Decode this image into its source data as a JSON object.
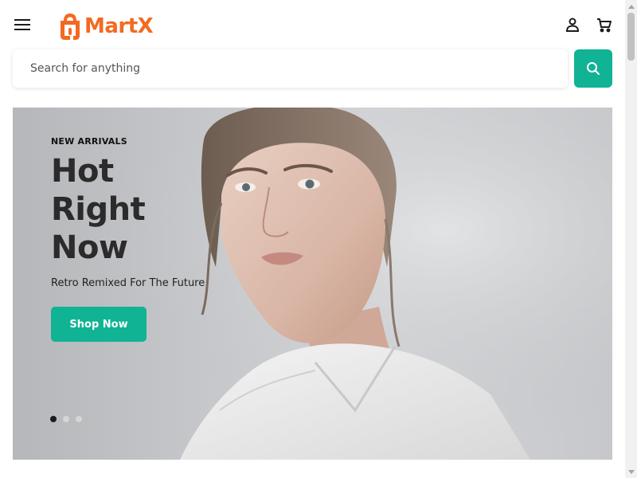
{
  "header": {
    "logo_text": "MartX",
    "brand_color": "#f26a21",
    "icons": [
      "hamburger-menu-icon",
      "shopping-bag-logo-icon",
      "user-icon",
      "cart-icon"
    ]
  },
  "search": {
    "placeholder": "Search for anything",
    "value": "",
    "button_icon": "search-icon",
    "accent": "#10b394"
  },
  "hero": {
    "eyebrow": "NEW ARRIVALS",
    "title_lines": [
      "Hot",
      "Right",
      "Now"
    ],
    "subtitle": "Retro Remixed For The Future",
    "cta_label": "Shop Now",
    "slides_total": 3,
    "active_slide": 1
  }
}
